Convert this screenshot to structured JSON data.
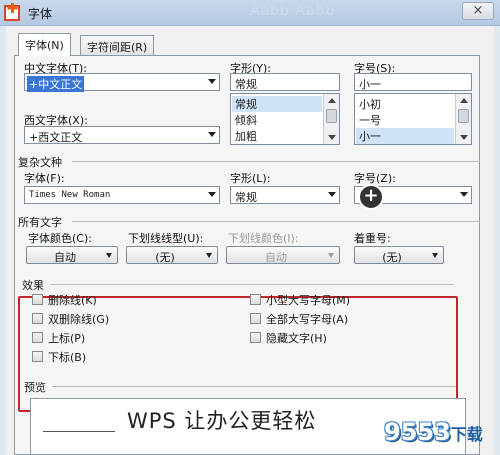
{
  "window": {
    "title": "字体",
    "ghost_text": "Aabb Aabb",
    "close_glyph": "×"
  },
  "tabs": [
    {
      "label": "字体(N)",
      "active": true
    },
    {
      "label": "字符间距(R)",
      "active": false
    }
  ],
  "chinese_font": {
    "label": "中文字体(T):",
    "value": "+中文正文"
  },
  "font_style": {
    "label": "字形(Y):",
    "value": "常规",
    "options": [
      "常规",
      "倾斜",
      "加粗"
    ]
  },
  "font_size": {
    "label": "字号(S):",
    "value": "小一",
    "options": [
      "小初",
      "一号",
      "小一"
    ]
  },
  "western_font": {
    "label": "西文字体(X):",
    "value": "+西文正文"
  },
  "complex_section": {
    "title": "复杂文种"
  },
  "complex_font": {
    "label": "字体(F):",
    "value": "Times New Roman"
  },
  "complex_style": {
    "label": "字形(L):",
    "value": "常规"
  },
  "complex_size": {
    "label": "字号(Z):",
    "value": "小一"
  },
  "all_text_section": {
    "title": "所有文字"
  },
  "font_color": {
    "label": "字体颜色(C):",
    "value": "自动"
  },
  "underline_type": {
    "label": "下划线线型(U):",
    "value": "(无)"
  },
  "underline_color": {
    "label": "下划线颜色(I):",
    "value": "自动",
    "disabled": true
  },
  "emphasis": {
    "label": "着重号:",
    "value": "(无)"
  },
  "effects": {
    "title": "效果",
    "left": [
      "删除线(K)",
      "双删除线(G)",
      "上标(P)",
      "下标(B)"
    ],
    "right": [
      "小型大写字母(M)",
      "全部大写字母(A)",
      "隐藏文字(H)"
    ]
  },
  "preview": {
    "title": "预览",
    "text": "WPS 让办公更轻松"
  },
  "cursor": {
    "glyph": "+"
  },
  "watermark": {
    "text": "9553",
    "sub": "下载"
  },
  "colors": {
    "accent_red": "#c0272d",
    "selection_blue": "#3875d7"
  }
}
